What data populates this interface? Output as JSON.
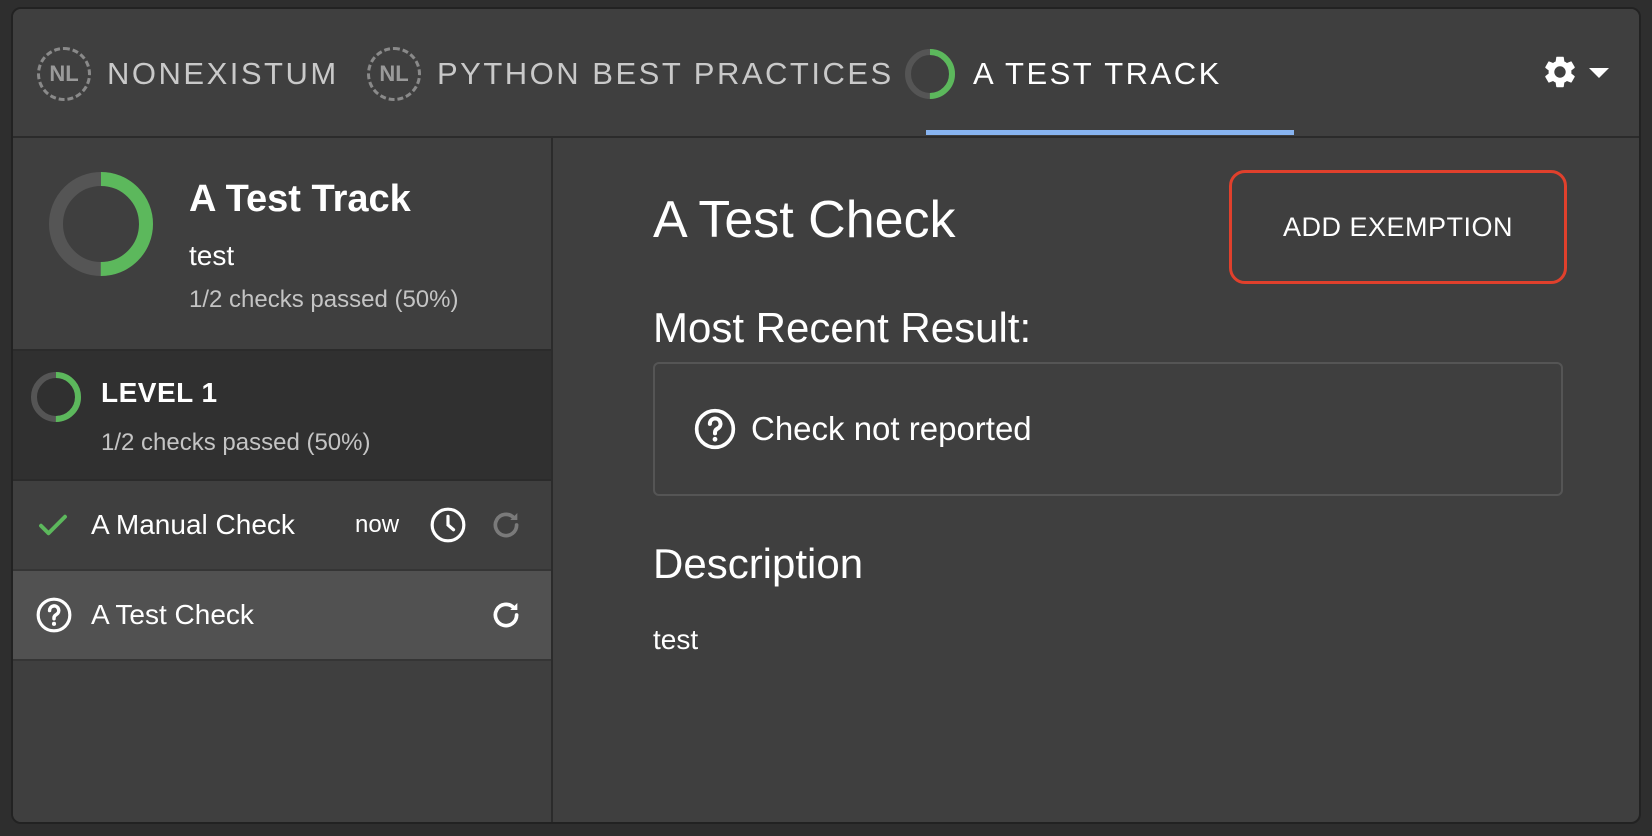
{
  "tabs": [
    {
      "badge": "NL",
      "label": "NONEXISTUM"
    },
    {
      "badge": "NL",
      "label": "PYTHON BEST PRACTICES"
    },
    {
      "label": "A TEST TRACK",
      "progress": 0.5,
      "active": true
    }
  ],
  "colors": {
    "accent_green": "#5cb85c",
    "tab_indicator": "#88b4f0",
    "highlight": "#e0402c"
  },
  "sidebar": {
    "track": {
      "title": "A Test Track",
      "subtitle": "test",
      "count": "1/2 checks passed (50%)",
      "progress": 0.5
    },
    "level": {
      "title": "LEVEL 1",
      "count": "1/2 checks passed (50%)",
      "progress": 0.5
    },
    "checks": [
      {
        "name": "A Manual Check",
        "time": "now",
        "status": "check-icon"
      },
      {
        "name": "A Test Check",
        "status": "question-icon",
        "selected": true
      }
    ]
  },
  "main": {
    "title": "A Test Check",
    "add_exemption": "ADD EXEMPTION",
    "result_label": "Most Recent Result:",
    "result_text": "Check not reported",
    "description_label": "Description",
    "description": "test"
  }
}
